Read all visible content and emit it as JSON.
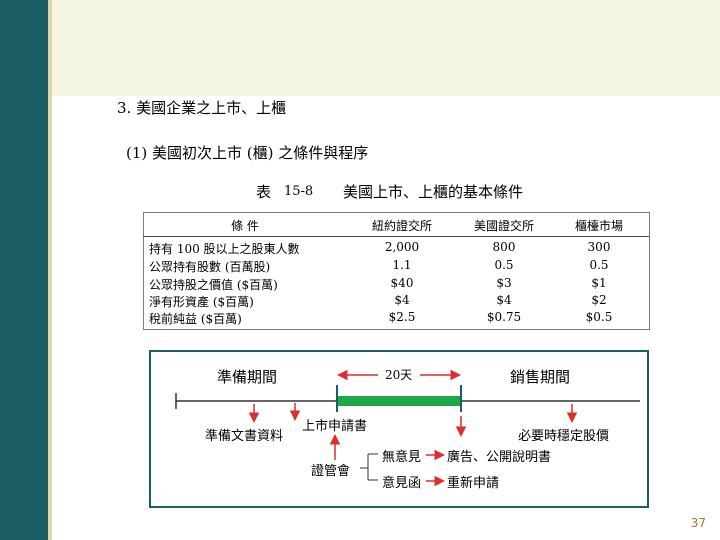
{
  "section_heading": "3.  美國企業之上市、上櫃",
  "sub_heading": "(1)  美國初次上市  (櫃)  之條件與程序",
  "table_caption": {
    "prefix": "表",
    "number": "15-8",
    "title": "美國上市、上櫃的基本條件"
  },
  "table": {
    "headers": [
      "條  件",
      "紐約證交所",
      "美國證交所",
      "櫃檯市場"
    ],
    "rows": [
      {
        "condition": "持有  100  股以上之股東人數",
        "nyse": "2,000",
        "amex": "800",
        "otc": "300"
      },
      {
        "condition": "公眾持有股數  (百萬股)",
        "nyse": "1.1",
        "amex": "0.5",
        "otc": "0.5"
      },
      {
        "condition": "公眾持股之價值  ($百萬)",
        "nyse": "$40",
        "amex": "$3",
        "otc": "$1"
      },
      {
        "condition": "淨有形資產  ($百萬)",
        "nyse": "$4",
        "amex": "$4",
        "otc": "$2"
      },
      {
        "condition": "稅前純益  ($百萬)",
        "nyse": "$2.5",
        "amex": "$0.75",
        "otc": "$0.5"
      }
    ]
  },
  "diagram": {
    "prep_period": "準備期間",
    "sales_period": "銷售期間",
    "duration": "20天",
    "prep_docs": "準備文書資料",
    "listing_application": "上市申請書",
    "sec": "證管會",
    "no_objection": "無意見",
    "comment_letter": "意見函",
    "ads": "廣告、公開說明書",
    "reapply": "重新申請",
    "stabilize": "必要時穩定股價",
    "colors": {
      "arrow": "#d9302c",
      "period_bar": "#1fa84a",
      "frame": "#1b5e66"
    }
  },
  "page_number": "37"
}
